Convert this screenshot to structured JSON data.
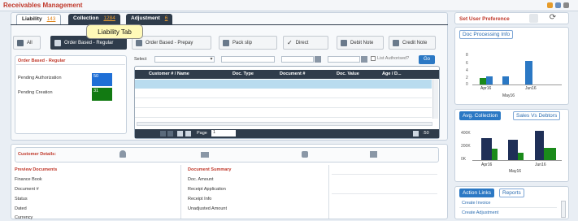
{
  "app": {
    "title": "Receivables Management"
  },
  "tabs": [
    {
      "label": "Liability",
      "count": "143"
    },
    {
      "label": "Collection",
      "count": "1284"
    },
    {
      "label": "Adjustment",
      "count": "6"
    }
  ],
  "callout": "Liability Tab",
  "toolbar": [
    "All",
    "Order Based - Regular",
    "Order Based - Prepay",
    "Pack slip",
    "Direct",
    "Debit Note",
    "Credit Note"
  ],
  "left_summary": {
    "title": "Order Based - Regular",
    "items": [
      {
        "label": "Pending Authorization",
        "value": "50"
      },
      {
        "label": "Pending Creation",
        "value": "31"
      }
    ]
  },
  "filters": {
    "select_label": "Select",
    "list_authorised": "List Authorised?",
    "go": "Go"
  },
  "grid": {
    "columns": [
      "Customer # / Name",
      "Doc. Type",
      "Document #",
      "Doc. Value",
      "Age / D..."
    ],
    "pager": {
      "page_label": "Page",
      "page": "1",
      "page_size": ":50"
    }
  },
  "details": {
    "title": "Customer Details:",
    "preview_title": "Preview Documents",
    "preview_items": [
      "Finance Book",
      "Document #",
      "Status",
      "Dated",
      "Currency"
    ],
    "summary_title": "Document Summary",
    "summary_items": [
      "Doc. Amount",
      "Receipt Application",
      "Receipt Info",
      "Unadjusted Amount"
    ]
  },
  "right": {
    "user_pref": "Set User Preference",
    "doc_processing": "Doc Processing Info",
    "chart1": {
      "ylabels": [
        "8",
        "6",
        "4",
        "2",
        "0"
      ],
      "xlabels": [
        "Apr16",
        "Jun16"
      ],
      "sublabel": "May16"
    },
    "tabs2": [
      "Avg. Collection",
      "Sales Vs Debtors"
    ],
    "chart2": {
      "ylabels": [
        "400K",
        "200K",
        "0K"
      ],
      "xlabels": [
        "Apr16",
        "Jun16"
      ],
      "sublabel": "May16"
    },
    "tabs3": [
      "Action Links",
      "Reports"
    ],
    "links": [
      "Create Invoice",
      "Create Adjustment"
    ]
  },
  "colors": {
    "accent": "#2b78c4",
    "dark": "#2f3c4b",
    "title_red": "#c0392b",
    "green": "#1a8a1a"
  }
}
